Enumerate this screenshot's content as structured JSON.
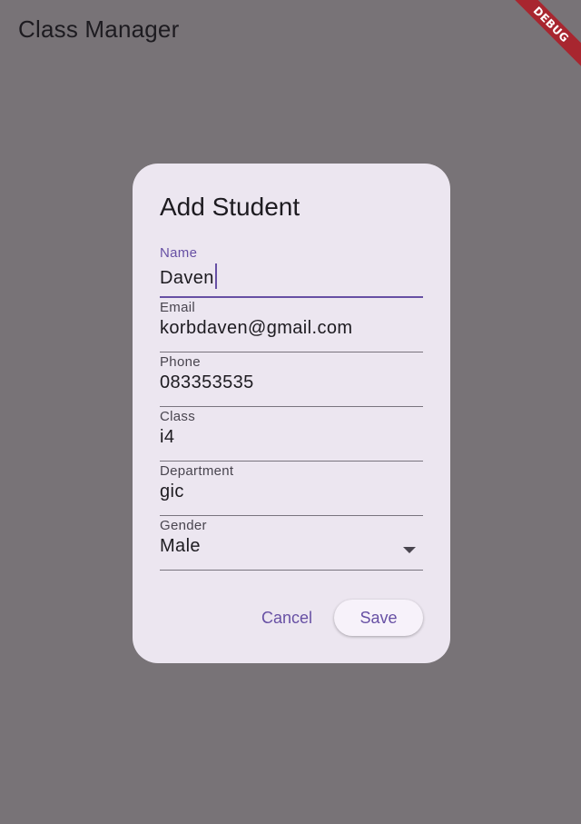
{
  "app": {
    "title": "Class Manager",
    "debug_label": "DEBUG"
  },
  "dialog": {
    "title": "Add Student",
    "fields": [
      {
        "label": "Name",
        "value": "Daven",
        "focused": true
      },
      {
        "label": "Email",
        "value": "korbdaven@gmail.com"
      },
      {
        "label": "Phone",
        "value": "083353535"
      },
      {
        "label": "Class",
        "value": "i4"
      },
      {
        "label": "Department",
        "value": "gic"
      },
      {
        "label": "Gender",
        "value": "Male",
        "type": "dropdown"
      }
    ],
    "cancel_label": "Cancel",
    "save_label": "Save"
  },
  "colors": {
    "scrim": "#787377",
    "dialog_bg": "#ece6f0",
    "accent": "#6750a4",
    "debug_banner": "#a8262f"
  },
  "icons": {
    "dropdown": "arrow-drop-down-icon"
  }
}
